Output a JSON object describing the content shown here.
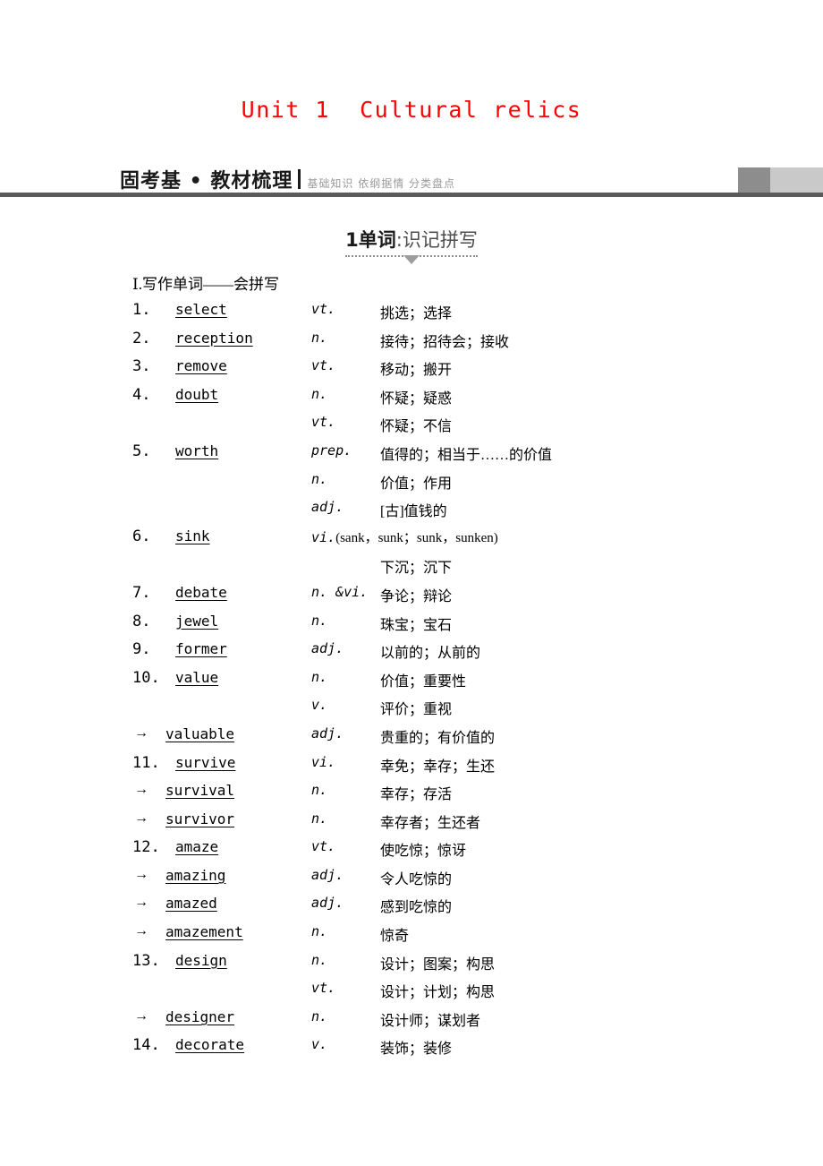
{
  "unit": {
    "title": "Unit 1  Cultural relics",
    "title_color": "#ff0000"
  },
  "header": {
    "label": "固考基 • 教材梳理",
    "subtitle": "基础知识 依纲据情 分类盘点",
    "rule_color": "#5b5b5b",
    "block_dark_color": "#8d8d8d",
    "block_light_color": "#c9c9c9"
  },
  "subsection": {
    "number": "1",
    "name": "单词",
    "colon": ":",
    "detail": "识记拼写"
  },
  "group_label": "Ⅰ.写作单词——会拼写",
  "rows": [
    {
      "num": "1.",
      "word": "select",
      "pos": "vt.",
      "forms": "",
      "cn": "挑选；选择"
    },
    {
      "num": "2.",
      "word": "reception",
      "pos": "n.",
      "forms": "",
      "cn": "接待；招待会；接收"
    },
    {
      "num": "3.",
      "word": "remove",
      "pos": "vt.",
      "forms": "",
      "cn": "移动；搬开"
    },
    {
      "num": "4.",
      "word": "doubt",
      "pos": "n.",
      "forms": "",
      "cn": "怀疑；疑惑"
    },
    {
      "num": "",
      "word": "",
      "pos": "vt.",
      "forms": "",
      "cn": "怀疑；不信"
    },
    {
      "num": "5.",
      "word": "worth",
      "pos": "prep.",
      "forms": "",
      "cn": "值得的；相当于……的价值"
    },
    {
      "num": "",
      "word": "",
      "pos": "n.",
      "forms": "",
      "cn": "价值；作用"
    },
    {
      "num": "",
      "word": "",
      "pos": "adj.",
      "forms": "",
      "cn": "[古]值钱的"
    },
    {
      "num": "6.",
      "word": "sink",
      "pos": "vi.",
      "forms": "(sank，sunk；sunk，sunken)",
      "cn": ""
    },
    {
      "num": "",
      "word": "",
      "pos": "",
      "forms": "",
      "cn": "下沉；沉下"
    },
    {
      "num": "7.",
      "word": "debate",
      "pos": "n. &vi.",
      "forms": "",
      "cn": "争论；辩论"
    },
    {
      "num": "8.",
      "word": "jewel",
      "pos": "n.",
      "forms": "",
      "cn": "珠宝；宝石"
    },
    {
      "num": "9.",
      "word": "former",
      "pos": "adj.",
      "forms": "",
      "cn": "以前的；从前的"
    },
    {
      "num": "10.",
      "word": "value",
      "pos": "n.",
      "forms": "",
      "cn": "价值；重要性"
    },
    {
      "num": "",
      "word": "",
      "pos": "v.",
      "forms": "",
      "cn": "评价；重视"
    },
    {
      "num": "→",
      "word": "valuable",
      "pos": "adj.",
      "forms": "",
      "cn": "贵重的；有价值的"
    },
    {
      "num": "11.",
      "word": "survive",
      "pos": "vi.",
      "forms": "",
      "cn": "幸免；幸存；生还"
    },
    {
      "num": "→",
      "word": "survival",
      "pos": "n.",
      "forms": "",
      "cn": "幸存；存活"
    },
    {
      "num": "→",
      "word": "survivor",
      "pos": "n.",
      "forms": "",
      "cn": "幸存者；生还者"
    },
    {
      "num": "12.",
      "word": "amaze",
      "pos": "vt.",
      "forms": "",
      "cn": "使吃惊；惊讶"
    },
    {
      "num": "→",
      "word": "amazing",
      "pos": "adj.",
      "forms": "",
      "cn": "令人吃惊的"
    },
    {
      "num": "→",
      "word": "amazed",
      "pos": "adj.",
      "forms": "",
      "cn": "感到吃惊的"
    },
    {
      "num": "→",
      "word": "amazement",
      "pos": "n.",
      "forms": "",
      "cn": "惊奇"
    },
    {
      "num": "13.",
      "word": "design",
      "pos": "n.",
      "forms": "",
      "cn": "设计；图案；构思"
    },
    {
      "num": "",
      "word": "",
      "pos": "vt.",
      "forms": "",
      "cn": "设计；计划；构思"
    },
    {
      "num": "→",
      "word": "designer",
      "pos": "n.",
      "forms": "",
      "cn": "设计师；谋划者"
    },
    {
      "num": "14.",
      "word": "decorate",
      "pos": "v.",
      "forms": "",
      "cn": "装饰；装修"
    }
  ]
}
